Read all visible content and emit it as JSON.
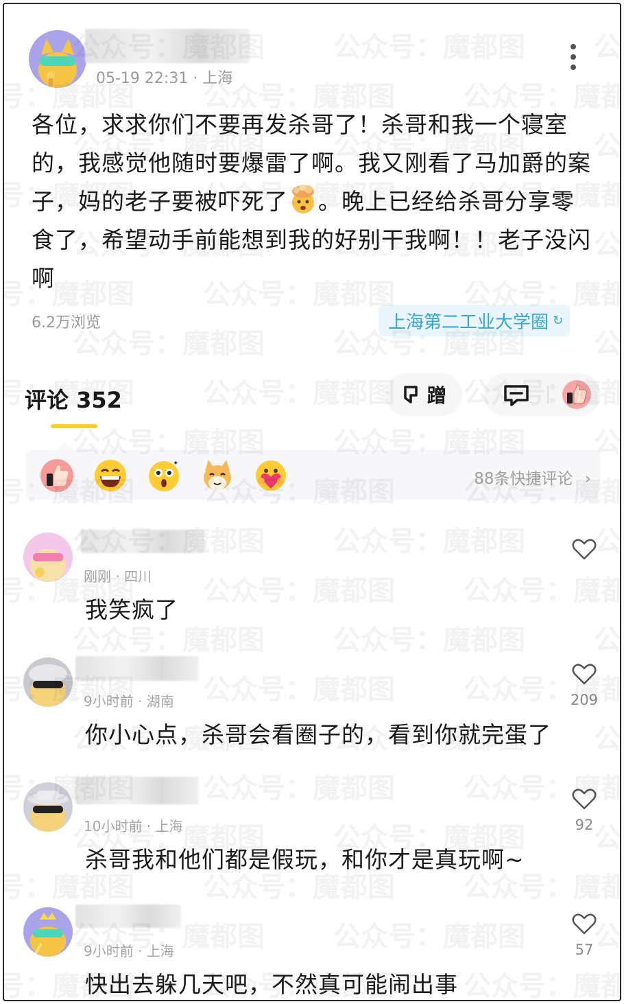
{
  "post": {
    "meta": "05-19 22:31 · 上海",
    "body_parts": [
      "各位，求求你们不要再发杀哥了！杀哥和我一个寝室的，我感觉他随时要爆雷了啊。我又刚看了马加爵的案子，妈的老子要被吓死了",
      "。晚上已经给杀哥分享零食了，希望动手前能想到我的好别干我啊！！老子没闪啊"
    ],
    "inline_emoji": "mind-blown-emoji",
    "views": "6.2万浏览",
    "circle_tag": "上海第二工业大学圈",
    "circle_tag_icon": "refresh-arrow"
  },
  "comments_header": {
    "title": "评论 352",
    "ceng_label": "蹭",
    "accent_color": "#ffd02a"
  },
  "quick_comments": {
    "emojis": [
      "thumbs-up-emoji",
      "laughing-emoji",
      "shocked-emoji",
      "shiba-dog-emoji",
      "heart-hug-emoji"
    ],
    "count_label": "88条快捷评论"
  },
  "comments": [
    {
      "meta": "刚刚 · 四川",
      "text": "我笑疯了",
      "likes": ""
    },
    {
      "meta": "9小时前 · 湖南",
      "text": "你小心点，杀哥会看圈子的，看到你就完蛋了",
      "likes": "209"
    },
    {
      "meta": "10小时前 · 上海",
      "text": "杀哥我和他们都是假玩，和你才是真玩啊~",
      "likes": "92"
    },
    {
      "meta": "9小时前 · 上海",
      "text": "快出去躲几天吧，不然真可能闹出事",
      "likes": "57"
    }
  ],
  "watermark_text": "公众号：魔都图"
}
